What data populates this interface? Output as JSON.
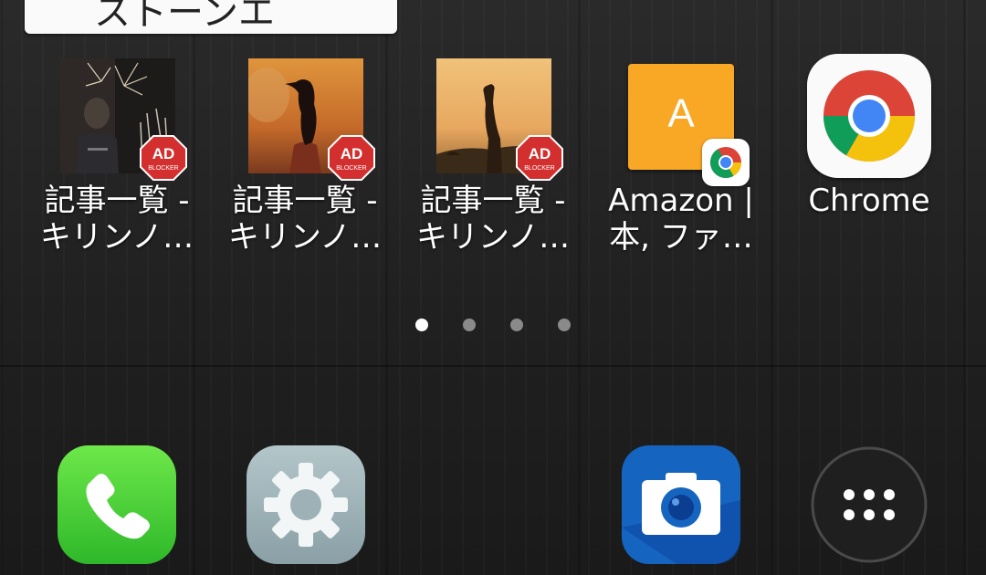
{
  "search_widget": {
    "text": "ストーンエ"
  },
  "apps": [
    {
      "label_line1": "記事一覧 -",
      "label_line2": "キリンノ…",
      "badge": "AD",
      "badge_sub": "BLOCKER",
      "icon": "fireworks-photo-icon"
    },
    {
      "label_line1": "記事一覧 -",
      "label_line2": "キリンノ…",
      "badge": "AD",
      "badge_sub": "BLOCKER",
      "icon": "bird-photo-icon"
    },
    {
      "label_line1": "記事一覧 -",
      "label_line2": "キリンノ…",
      "badge": "AD",
      "badge_sub": "BLOCKER",
      "icon": "giraffe-photo-icon"
    },
    {
      "label_line1": "Amazon |",
      "label_line2": "本, ファ…",
      "tile_letter": "A",
      "icon": "amazon-shortcut-icon"
    },
    {
      "label_line1": "Chrome",
      "label_line2": "",
      "icon": "chrome-icon"
    }
  ],
  "page_indicator": {
    "pages": 4,
    "active": 1
  },
  "dock": [
    {
      "name": "phone",
      "icon": "phone-icon"
    },
    {
      "name": "settings",
      "icon": "gear-icon"
    },
    {
      "name": "camera",
      "icon": "camera-icon"
    },
    {
      "name": "app-drawer",
      "icon": "app-drawer-icon"
    }
  ],
  "colors": {
    "phone_green": "#4cd137",
    "settings_grey": "#9fb3b8",
    "camera_blue": "#1a73e8",
    "amazon_tile": "#f9a825",
    "ad_red": "#d32f2f",
    "chrome_red": "#db4437",
    "chrome_yellow": "#f4c20d",
    "chrome_green": "#0f9d58",
    "chrome_blue": "#4285f4"
  }
}
